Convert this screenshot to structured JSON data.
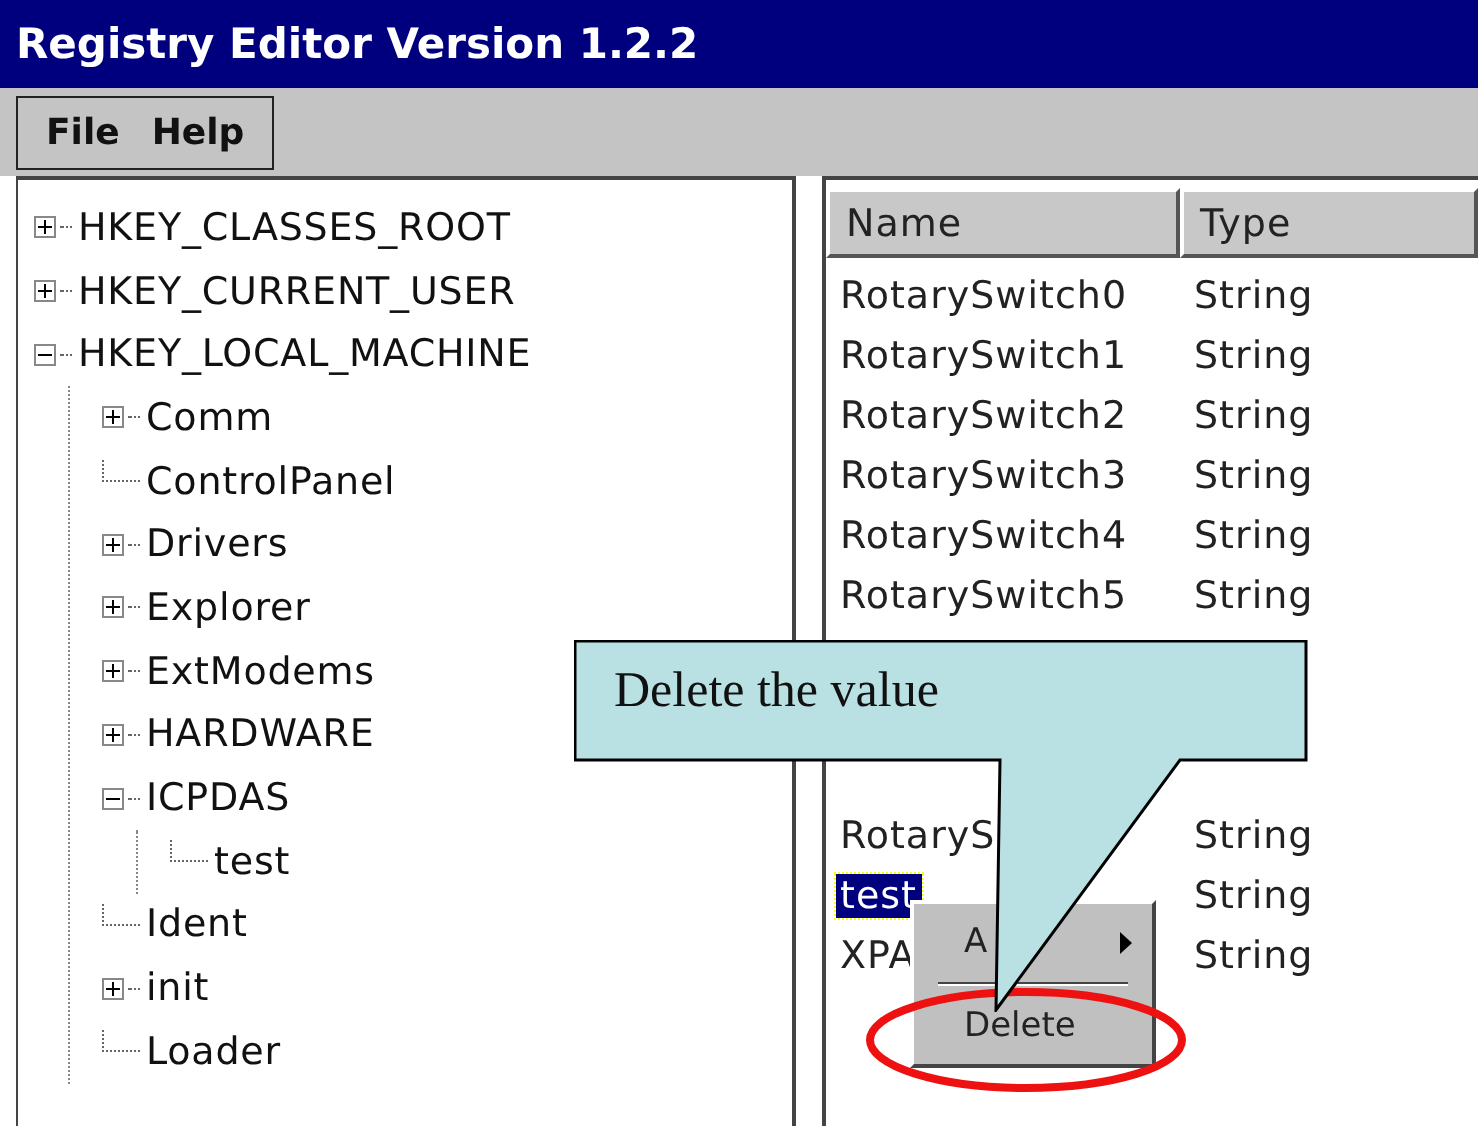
{
  "window": {
    "title": "Registry Editor Version 1.2.2"
  },
  "menu": [
    {
      "label": "File"
    },
    {
      "label": "Help"
    }
  ],
  "tree": [
    {
      "label": "HKEY_CLASSES_ROOT",
      "expandable": true,
      "expanded": false
    },
    {
      "label": "HKEY_CURRENT_USER",
      "expandable": true,
      "expanded": false
    },
    {
      "label": "HKEY_LOCAL_MACHINE",
      "expandable": true,
      "expanded": true,
      "children": [
        {
          "label": "Comm",
          "expandable": true,
          "expanded": false
        },
        {
          "label": "ControlPanel",
          "expandable": false
        },
        {
          "label": "Drivers",
          "expandable": true,
          "expanded": false
        },
        {
          "label": "Explorer",
          "expandable": true,
          "expanded": false
        },
        {
          "label": "ExtModems",
          "expandable": true,
          "expanded": false
        },
        {
          "label": "HARDWARE",
          "expandable": true,
          "expanded": false
        },
        {
          "label": "ICPDAS",
          "expandable": true,
          "expanded": true,
          "children": [
            {
              "label": "test",
              "expandable": false
            }
          ]
        },
        {
          "label": "Ident",
          "expandable": false
        },
        {
          "label": "init",
          "expandable": true,
          "expanded": false
        },
        {
          "label": "Loader",
          "expandable": false
        }
      ]
    }
  ],
  "table": {
    "columns": [
      "Name",
      "Type"
    ],
    "rows": [
      {
        "kind": "value",
        "name": "RotarySwitch0",
        "type": "String",
        "selected": false
      },
      {
        "kind": "value",
        "name": "RotarySwitch1",
        "type": "String",
        "selected": false
      },
      {
        "kind": "value",
        "name": "RotarySwitch2",
        "type": "String",
        "selected": false
      },
      {
        "kind": "value",
        "name": "RotarySwitch3",
        "type": "String",
        "selected": false
      },
      {
        "kind": "value",
        "name": "RotarySwitch4",
        "type": "String",
        "selected": false
      },
      {
        "kind": "value",
        "name": "RotarySwitch5",
        "type": "String",
        "selected": false
      },
      {
        "kind": "covered"
      },
      {
        "kind": "covered"
      },
      {
        "kind": "covered"
      },
      {
        "kind": "value",
        "name": "RotaryS",
        "type": "String",
        "selected": false
      },
      {
        "kind": "value",
        "name": "test",
        "type": "String",
        "selected": true
      },
      {
        "kind": "value",
        "name": "XPA",
        "type": "String",
        "selected": false
      }
    ]
  },
  "context_menu": {
    "items": [
      {
        "kind": "submenu",
        "label": "A"
      },
      {
        "kind": "separator"
      },
      {
        "kind": "command",
        "label": "Delete",
        "highlighted": true
      }
    ]
  },
  "callout": {
    "text": "Delete the value"
  }
}
